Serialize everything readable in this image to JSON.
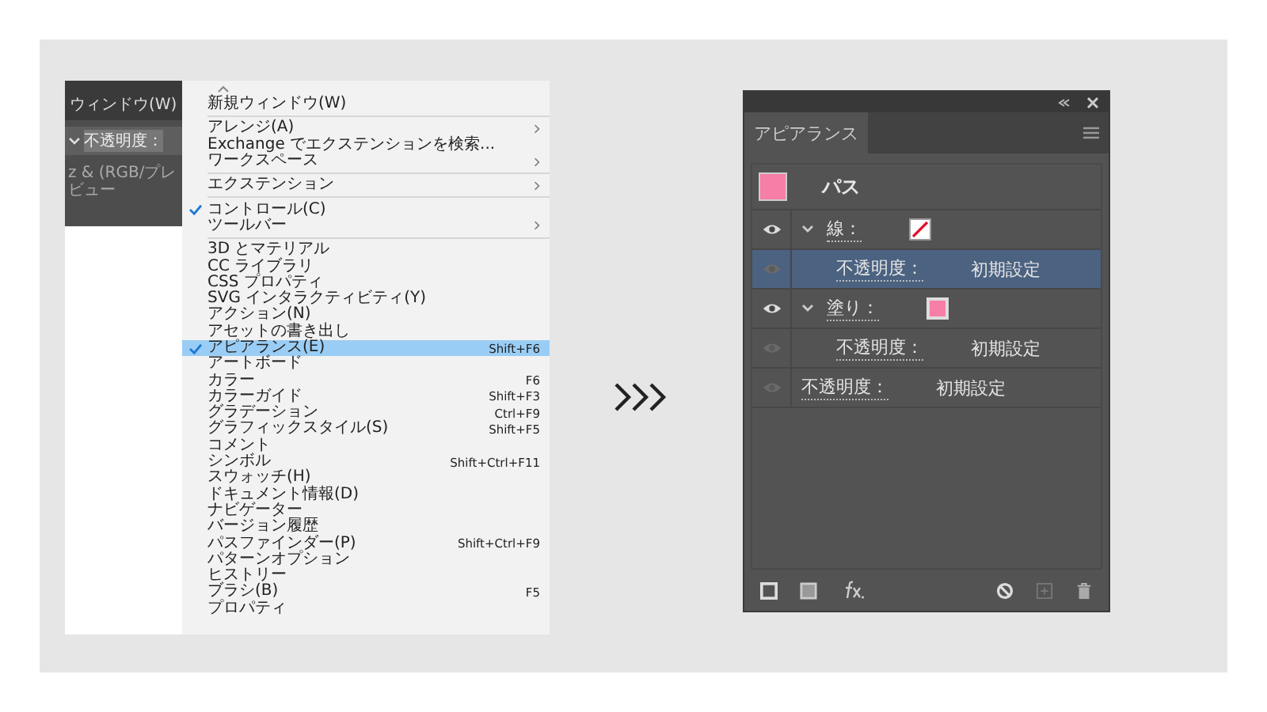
{
  "control_bar": {
    "menu_title": "ウィンドウ(W)",
    "opacity_label": "不透明度：",
    "mode_text": "z & (RGB/プレビュー"
  },
  "window_menu": {
    "sections": [
      [
        {
          "label": "新規ウィンドウ(W)",
          "checked": false,
          "selected": false,
          "submenu": false
        }
      ],
      [
        {
          "label": "アレンジ(A)",
          "checked": false,
          "selected": false,
          "submenu": true
        },
        {
          "label": "Exchange でエクステンションを検索...",
          "checked": false,
          "selected": false,
          "submenu": false
        },
        {
          "label": "ワークスペース",
          "checked": false,
          "selected": false,
          "submenu": true
        }
      ],
      [
        {
          "label": "エクステンション",
          "checked": false,
          "selected": false,
          "submenu": true
        }
      ],
      [
        {
          "label": "コントロール(C)",
          "checked": true,
          "selected": false,
          "submenu": false
        },
        {
          "label": "ツールバー",
          "checked": false,
          "selected": false,
          "submenu": true
        }
      ],
      [
        {
          "label": "3D とマテリアル",
          "checked": false,
          "selected": false,
          "submenu": false
        },
        {
          "label": "CC ライブラリ",
          "checked": false,
          "selected": false,
          "submenu": false
        },
        {
          "label": "CSS プロパティ",
          "checked": false,
          "selected": false,
          "submenu": false
        },
        {
          "label": "SVG インタラクティビティ(Y)",
          "checked": false,
          "selected": false,
          "submenu": false
        },
        {
          "label": "アクション(N)",
          "checked": false,
          "selected": false,
          "submenu": false
        },
        {
          "label": "アセットの書き出し",
          "checked": false,
          "selected": false,
          "submenu": false
        },
        {
          "label": "アピアランス(E)",
          "shortcut": "Shift+F6",
          "checked": true,
          "selected": true,
          "submenu": false
        },
        {
          "label": "アートボード",
          "checked": false,
          "selected": false,
          "submenu": false
        },
        {
          "label": "カラー",
          "shortcut": "F6",
          "checked": false,
          "selected": false,
          "submenu": false
        },
        {
          "label": "カラーガイド",
          "shortcut": "Shift+F3",
          "checked": false,
          "selected": false,
          "submenu": false
        },
        {
          "label": "グラデーション",
          "shortcut": "Ctrl+F9",
          "checked": false,
          "selected": false,
          "submenu": false
        },
        {
          "label": "グラフィックスタイル(S)",
          "shortcut": "Shift+F5",
          "checked": false,
          "selected": false,
          "submenu": false
        },
        {
          "label": "コメント",
          "checked": false,
          "selected": false,
          "submenu": false
        },
        {
          "label": "シンボル",
          "shortcut": "Shift+Ctrl+F11",
          "checked": false,
          "selected": false,
          "submenu": false
        },
        {
          "label": "スウォッチ(H)",
          "checked": false,
          "selected": false,
          "submenu": false
        },
        {
          "label": "ドキュメント情報(D)",
          "checked": false,
          "selected": false,
          "submenu": false
        },
        {
          "label": "ナビゲーター",
          "checked": false,
          "selected": false,
          "submenu": false
        },
        {
          "label": "バージョン履歴",
          "checked": false,
          "selected": false,
          "submenu": false
        },
        {
          "label": "パスファインダー(P)",
          "shortcut": "Shift+Ctrl+F9",
          "checked": false,
          "selected": false,
          "submenu": false
        },
        {
          "label": "パターンオプション",
          "checked": false,
          "selected": false,
          "submenu": false
        },
        {
          "label": "ヒストリー",
          "checked": false,
          "selected": false,
          "submenu": false
        },
        {
          "label": "ブラシ(B)",
          "shortcut": "F5",
          "checked": false,
          "selected": false,
          "submenu": false
        },
        {
          "label": "プロパティ",
          "checked": false,
          "selected": false,
          "submenu": false
        }
      ]
    ]
  },
  "appearance_panel": {
    "tab": {
      "label": "アピアランス",
      "selected": true
    },
    "object": {
      "label": "パス",
      "color": "#f77ea6"
    },
    "rows": [
      {
        "kind": "stroke",
        "label": "線：",
        "visible": true,
        "expanded": true,
        "selected": false,
        "children": [
          {
            "kind": "opacity",
            "label": "不透明度：",
            "value": "初期設定",
            "visible": false,
            "selected": true
          }
        ]
      },
      {
        "kind": "fill",
        "label": "塗り：",
        "color": "#f77ea6",
        "visible": true,
        "expanded": true,
        "selected": false,
        "children": [
          {
            "kind": "opacity",
            "label": "不透明度：",
            "value": "初期設定",
            "visible": false,
            "selected": false
          }
        ]
      },
      {
        "kind": "opacity",
        "label": "不透明度：",
        "value": "初期設定",
        "visible": false,
        "selected": false
      }
    ]
  }
}
